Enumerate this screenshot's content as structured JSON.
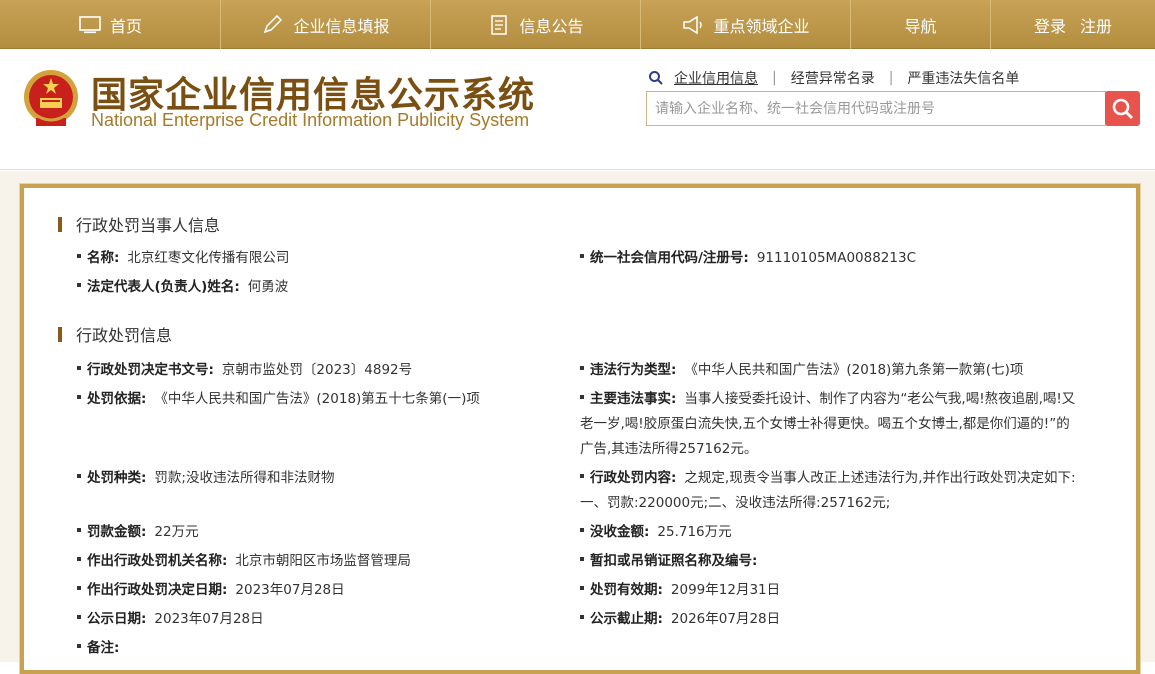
{
  "nav": {
    "home": "首页",
    "fill": "企业信息填报",
    "notice": "信息公告",
    "key": "重点领域企业",
    "guide": "导航",
    "login": "登录",
    "register": "注册"
  },
  "header": {
    "title_cn": "国家企业信用信息公示系统",
    "title_en": "National Enterprise Credit Information Publicity System",
    "links": [
      "企业信用信息",
      "经营异常名录",
      "严重违法失信名单"
    ],
    "search_placeholder": "请输入企业名称、统一社会信用代码或注册号"
  },
  "party": {
    "section_title": "行政处罚当事人信息",
    "name_label": "名称:",
    "name_value": "北京红枣文化传播有限公司",
    "code_label": "统一社会信用代码/注册号:",
    "code_value": "91110105MA0088213C",
    "rep_label": "法定代表人(负责人)姓名:",
    "rep_value": "何勇波"
  },
  "penalty": {
    "section_title": "行政处罚信息",
    "doc_label": "行政处罚决定书文号:",
    "doc_value": "京朝市监处罚〔2023〕4892号",
    "type_label": "违法行为类型:",
    "type_value": "《中华人民共和国广告法》(2018)第九条第一款第(七)项",
    "basis_label": "处罚依据:",
    "basis_value": "《中华人民共和国广告法》(2018)第五十七条第(一)项",
    "facts_label": "主要违法事实:",
    "facts_value": "当事人接受委托设计、制作了内容为“老公气我,喝!熬夜追剧,喝!又老一岁,喝!胶原蛋白流失快,五个女博士补得更快。喝五个女博士,都是你们逼的!”的广告,其违法所得257162元。",
    "kind_label": "处罚种类:",
    "kind_value": "罚款;没收违法所得和非法财物",
    "content_label": "行政处罚内容:",
    "content_value": "之规定,现责令当事人改正上述违法行为,并作出行政处罚决定如下:一、罚款:220000元;二、没收违法所得:257162元;",
    "fine_label": "罚款金额:",
    "fine_value": "22万元",
    "confiscate_label": "没收金额:",
    "confiscate_value": "25.716万元",
    "authority_label": "作出行政处罚机关名称:",
    "authority_value": "北京市朝阳区市场监督管理局",
    "license_label": "暂扣或吊销证照名称及编号:",
    "license_value": "",
    "date_label": "作出行政处罚决定日期:",
    "date_value": "2023年07月28日",
    "valid_label": "处罚有效期:",
    "valid_value": "2099年12月31日",
    "pub_label": "公示日期:",
    "pub_value": "2023年07月28日",
    "pubend_label": "公示截止期:",
    "pubend_value": "2026年07月28日",
    "remark_label": "备注:",
    "remark_value": ""
  }
}
